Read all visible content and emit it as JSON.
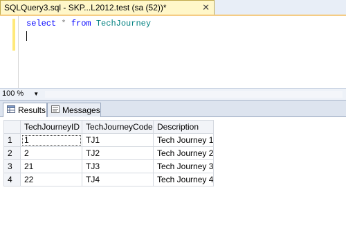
{
  "document_tab": {
    "title": "SQLQuery3.sql - SKP...L2012.test (sa (52))*",
    "close_glyph": "✕"
  },
  "editor": {
    "keyword_select": "select",
    "star": "*",
    "keyword_from": "from",
    "table": "TechJourney"
  },
  "zoom": {
    "value": "100 %",
    "arrow": "▼"
  },
  "results_tabs": [
    {
      "label": "Results",
      "icon": "grid-icon"
    },
    {
      "label": "Messages",
      "icon": "messages-icon"
    }
  ],
  "grid": {
    "columns": [
      "TechJourneyID",
      "TechJourneyCode",
      "Description"
    ],
    "rows": [
      {
        "num": "1",
        "id": "1",
        "code": "TJ1",
        "desc": "Tech Journey 1"
      },
      {
        "num": "2",
        "id": "2",
        "code": "TJ2",
        "desc": "Tech Journey 2"
      },
      {
        "num": "3",
        "id": "21",
        "code": "TJ3",
        "desc": "Tech Journey 3"
      },
      {
        "num": "4",
        "id": "22",
        "code": "TJ4",
        "desc": "Tech Journey 4"
      }
    ]
  },
  "colors": {
    "tab_bg": "#fff7c9",
    "keyword": "#0000ff",
    "identifier": "#008080"
  }
}
